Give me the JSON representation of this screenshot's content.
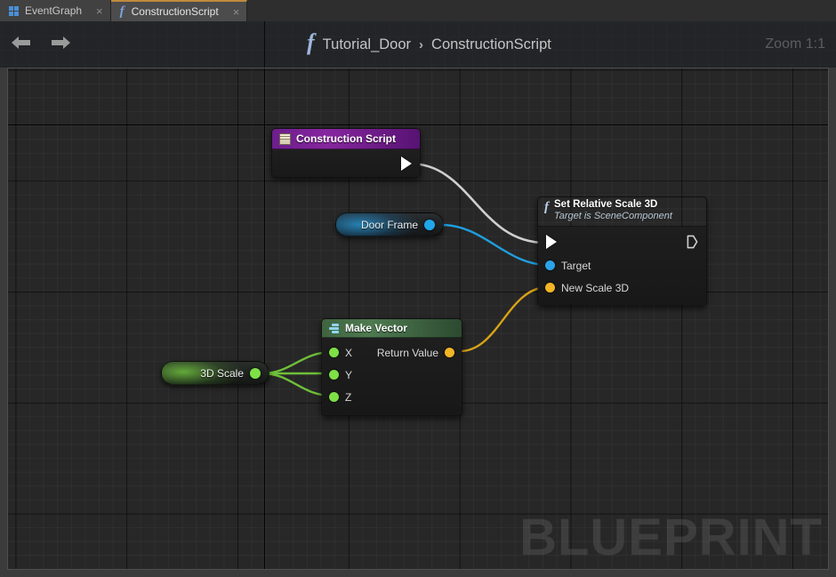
{
  "window": {
    "zoom_label": "Zoom 1:1"
  },
  "tabs": [
    {
      "label": "EventGraph",
      "icon": "eventgraph-icon",
      "close": "×",
      "active": false
    },
    {
      "label": "ConstructionScript",
      "icon": "function-icon",
      "close": "×",
      "active": true
    }
  ],
  "breadcrumb": {
    "icon": "function-icon",
    "root": "Tutorial_Door",
    "separator": "›",
    "leaf": "ConstructionScript"
  },
  "nav": {
    "back": "back-arrow-icon",
    "forward": "forward-arrow-icon"
  },
  "canvas": {
    "watermark": "BLUEPRINT"
  },
  "nodes": {
    "construction_script": {
      "title": "Construction Script",
      "icon": "construction-script-icon",
      "exec_out": "exec-out-pin"
    },
    "set_relative_scale_3d": {
      "title": "Set Relative Scale 3D",
      "subtitle": "Target is SceneComponent",
      "icon": "function-icon",
      "exec_in": "exec-in-pin",
      "exec_out": "exec-out-pin",
      "inputs": [
        {
          "label": "Target",
          "color": "#2aa3e8",
          "type": "object"
        },
        {
          "label": "New Scale 3D",
          "color": "#f2b525",
          "type": "vector"
        }
      ]
    },
    "make_vector": {
      "title": "Make Vector",
      "icon": "make-vector-icon",
      "inputs": [
        {
          "label": "X",
          "color": "#7ee045"
        },
        {
          "label": "Y",
          "color": "#7ee045"
        },
        {
          "label": "Z",
          "color": "#7ee045"
        }
      ],
      "output": {
        "label": "Return Value",
        "color": "#f2b525"
      }
    }
  },
  "pills": [
    {
      "label": "Door Frame",
      "color": "#21a7ea",
      "name": "variable-door-frame"
    },
    {
      "label": "3D Scale",
      "color": "#7ee045",
      "name": "variable-3d-scale"
    }
  ],
  "colors": {
    "exec_wire": "#cfcfcf",
    "object_wire": "#1f9ede",
    "vector_wire": "#d9a316",
    "float_wire": "#6fbf38",
    "tab_active_accent": "#c08a3e"
  }
}
